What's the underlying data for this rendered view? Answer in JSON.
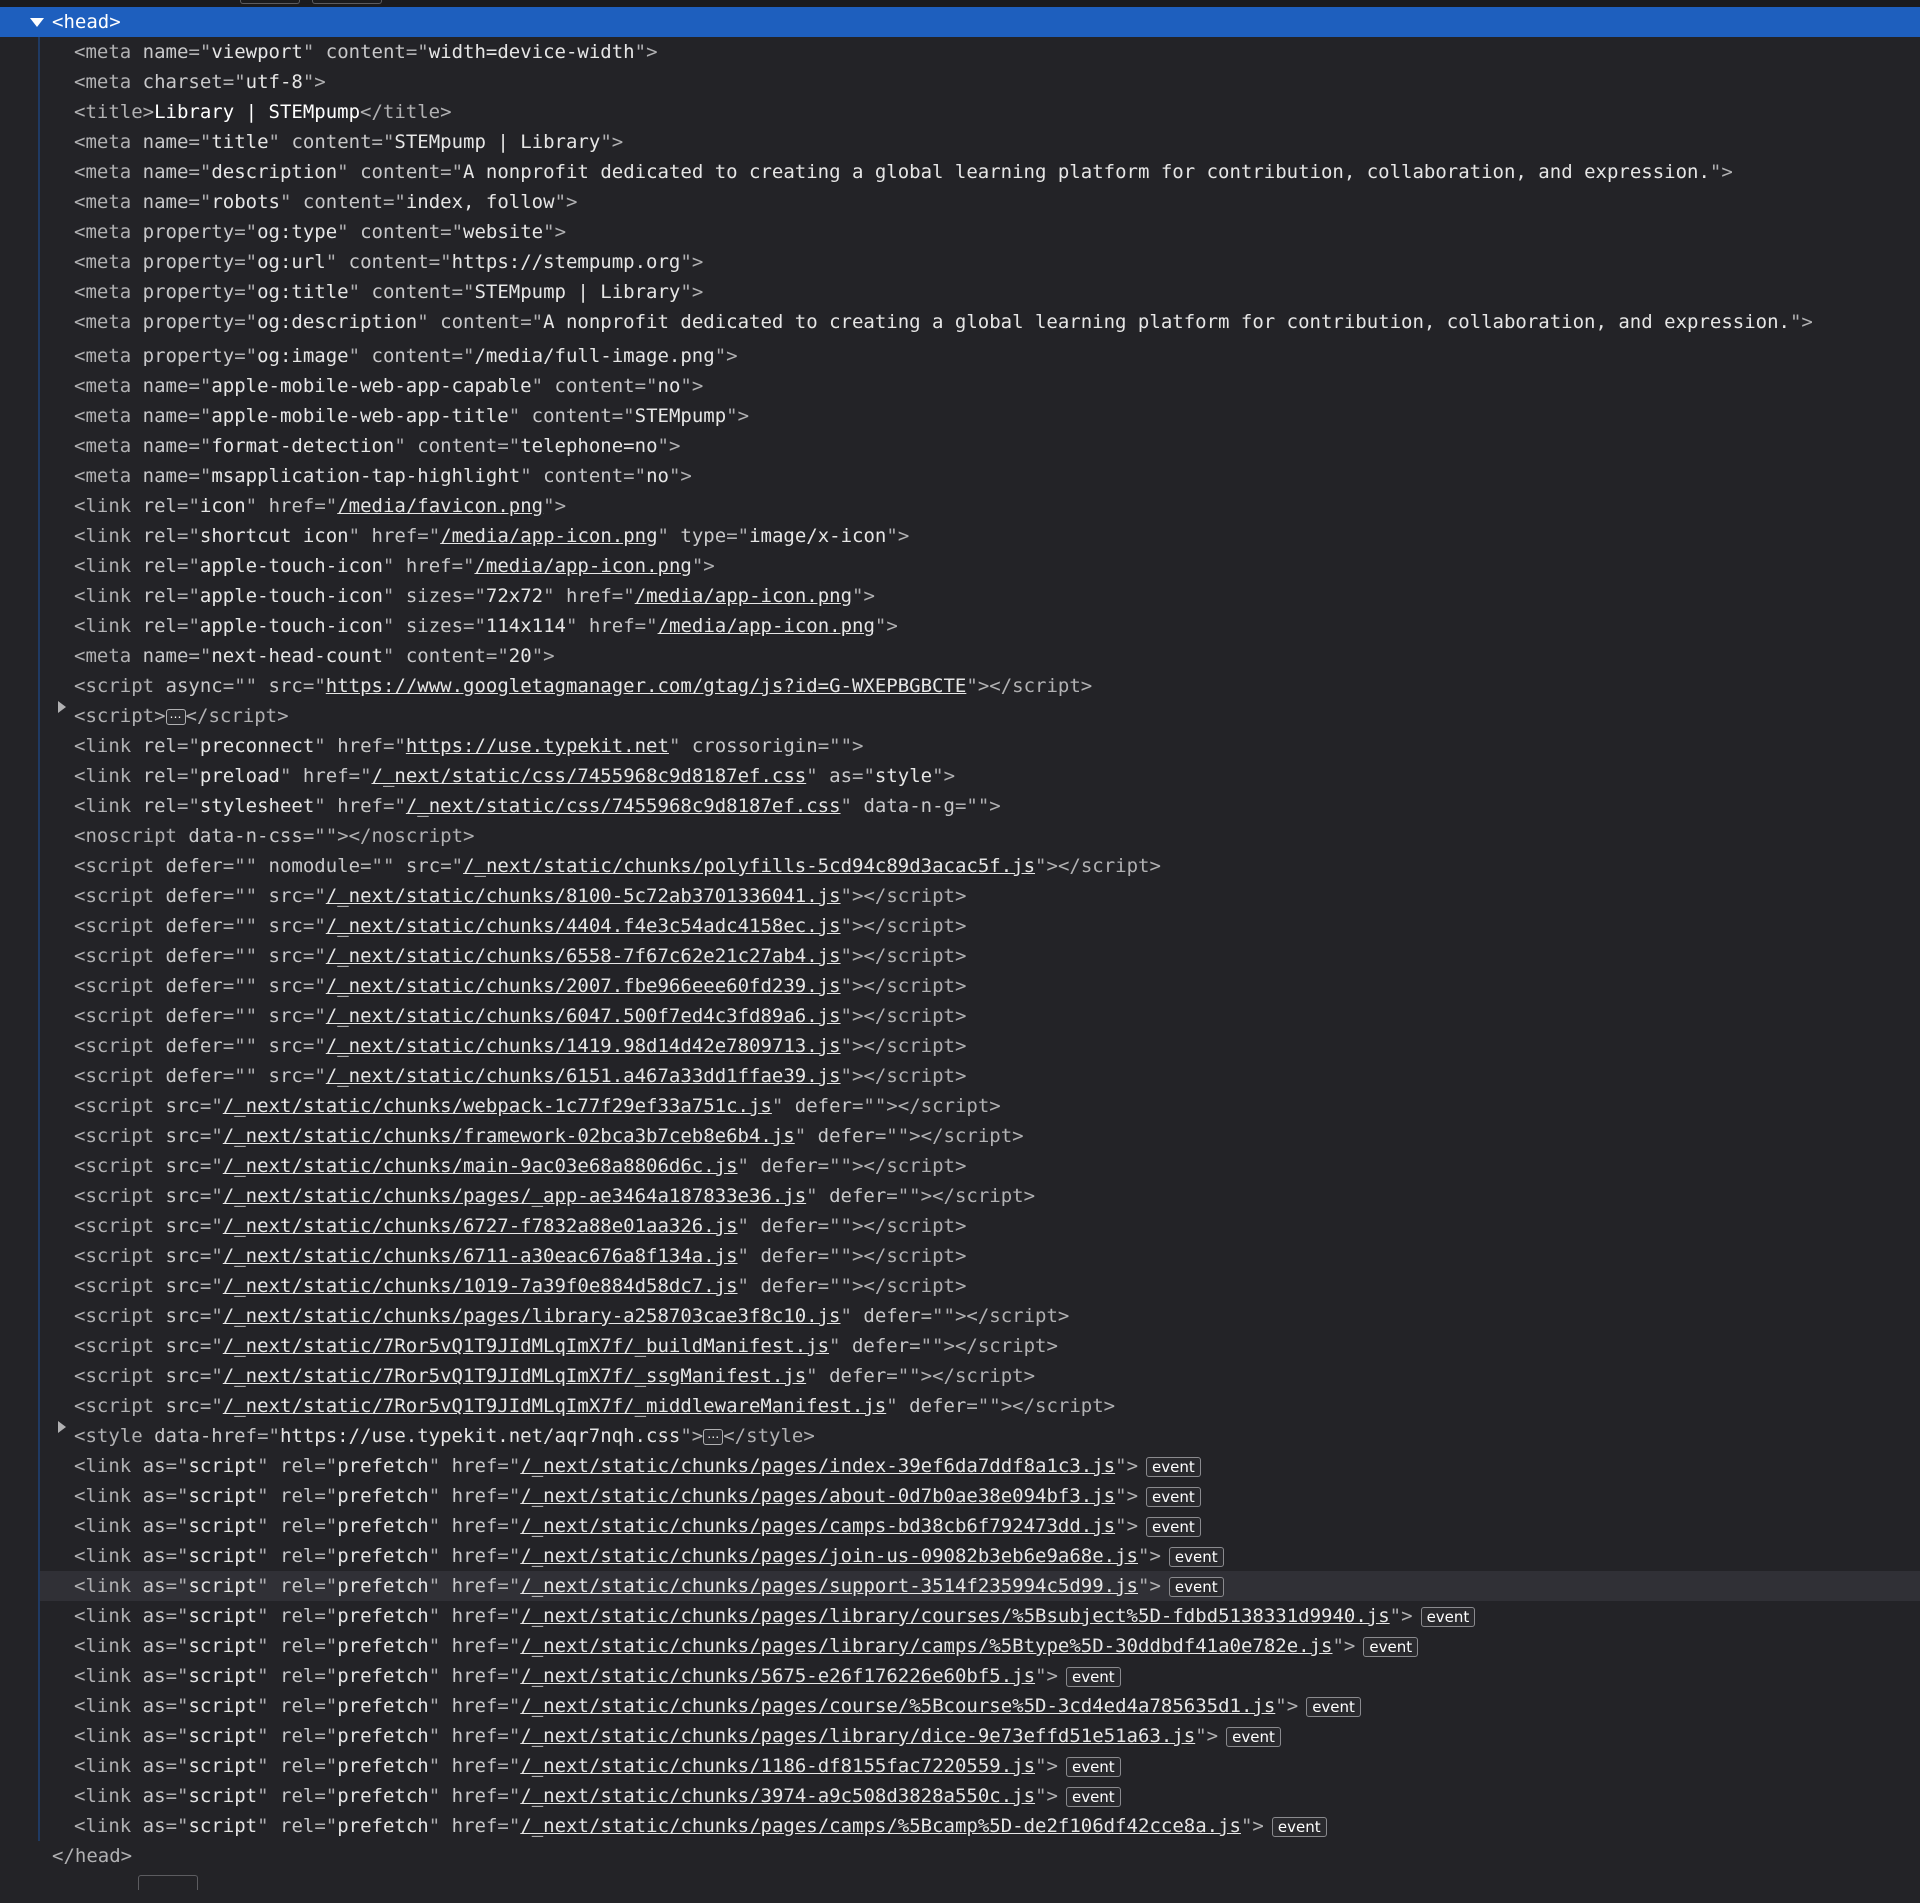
{
  "head_node": {
    "open": "<head>",
    "close": "</head>"
  },
  "badge_label": "event",
  "nodes": [
    {
      "kind": "attrs",
      "tag": "meta",
      "attrs": [
        [
          "name",
          "viewport"
        ],
        [
          "content",
          "width=device-width"
        ]
      ]
    },
    {
      "kind": "attrs",
      "tag": "meta",
      "attrs": [
        [
          "charset",
          "utf-8"
        ]
      ]
    },
    {
      "kind": "text",
      "tag": "title",
      "text": "Library | STEMpump"
    },
    {
      "kind": "attrs",
      "tag": "meta",
      "attrs": [
        [
          "name",
          "title"
        ],
        [
          "content",
          "STEMpump | Library"
        ]
      ]
    },
    {
      "kind": "attrs",
      "tag": "meta",
      "attrs": [
        [
          "name",
          "description"
        ],
        [
          "content",
          "A nonprofit dedicated to creating a global learning platform for contribution, collaboration, and expression."
        ]
      ]
    },
    {
      "kind": "attrs",
      "tag": "meta",
      "attrs": [
        [
          "name",
          "robots"
        ],
        [
          "content",
          "index, follow"
        ]
      ]
    },
    {
      "kind": "attrs",
      "tag": "meta",
      "attrs": [
        [
          "property",
          "og:type"
        ],
        [
          "content",
          "website"
        ]
      ]
    },
    {
      "kind": "attrs",
      "tag": "meta",
      "attrs": [
        [
          "property",
          "og:url"
        ],
        [
          "content",
          "https://stempump.org"
        ]
      ]
    },
    {
      "kind": "attrs",
      "tag": "meta",
      "attrs": [
        [
          "property",
          "og:title"
        ],
        [
          "content",
          "STEMpump | Library"
        ]
      ]
    },
    {
      "kind": "attrs",
      "tag": "meta",
      "wrap": true,
      "attrs": [
        [
          "property",
          "og:description"
        ],
        [
          "content",
          "A nonprofit dedicated to creating a global learning platform for contribution, collaboration, and expression."
        ]
      ]
    },
    {
      "kind": "attrs",
      "tag": "meta",
      "attrs": [
        [
          "property",
          "og:image"
        ],
        [
          "content",
          "/media/full-image.png"
        ]
      ]
    },
    {
      "kind": "attrs",
      "tag": "meta",
      "attrs": [
        [
          "name",
          "apple-mobile-web-app-capable"
        ],
        [
          "content",
          "no"
        ]
      ]
    },
    {
      "kind": "attrs",
      "tag": "meta",
      "attrs": [
        [
          "name",
          "apple-mobile-web-app-title"
        ],
        [
          "content",
          "STEMpump"
        ]
      ]
    },
    {
      "kind": "attrs",
      "tag": "meta",
      "attrs": [
        [
          "name",
          "format-detection"
        ],
        [
          "content",
          "telephone=no"
        ]
      ]
    },
    {
      "kind": "attrs",
      "tag": "meta",
      "attrs": [
        [
          "name",
          "msapplication-tap-highlight"
        ],
        [
          "content",
          "no"
        ]
      ]
    },
    {
      "kind": "attrs",
      "tag": "link",
      "attrs": [
        [
          "rel",
          "icon"
        ],
        [
          "href",
          "/media/favicon.png",
          true
        ]
      ]
    },
    {
      "kind": "attrs",
      "tag": "link",
      "attrs": [
        [
          "rel",
          "shortcut icon"
        ],
        [
          "href",
          "/media/app-icon.png",
          true
        ],
        [
          "type",
          "image/x-icon"
        ]
      ]
    },
    {
      "kind": "attrs",
      "tag": "link",
      "attrs": [
        [
          "rel",
          "apple-touch-icon"
        ],
        [
          "href",
          "/media/app-icon.png",
          true
        ]
      ]
    },
    {
      "kind": "attrs",
      "tag": "link",
      "attrs": [
        [
          "rel",
          "apple-touch-icon"
        ],
        [
          "sizes",
          "72x72"
        ],
        [
          "href",
          "/media/app-icon.png",
          true
        ]
      ]
    },
    {
      "kind": "attrs",
      "tag": "link",
      "attrs": [
        [
          "rel",
          "apple-touch-icon"
        ],
        [
          "sizes",
          "114x114"
        ],
        [
          "href",
          "/media/app-icon.png",
          true
        ]
      ]
    },
    {
      "kind": "attrs",
      "tag": "meta",
      "attrs": [
        [
          "name",
          "next-head-count"
        ],
        [
          "content",
          "20"
        ]
      ]
    },
    {
      "kind": "attrs",
      "tag": "script",
      "close": true,
      "attrs": [
        [
          "async",
          ""
        ],
        [
          "src",
          "https://www.googletagmanager.com/gtag/js?id=G-WXEPBGBCTE",
          true
        ]
      ]
    },
    {
      "kind": "collapsed",
      "tag": "script",
      "attrs": []
    },
    {
      "kind": "attrs",
      "tag": "link",
      "attrs": [
        [
          "rel",
          "preconnect"
        ],
        [
          "href",
          "https://use.typekit.net",
          true
        ],
        [
          "crossorigin",
          ""
        ]
      ]
    },
    {
      "kind": "attrs",
      "tag": "link",
      "attrs": [
        [
          "rel",
          "preload"
        ],
        [
          "href",
          "/_next/static/css/7455968c9d8187ef.css",
          true
        ],
        [
          "as",
          "style"
        ]
      ]
    },
    {
      "kind": "attrs",
      "tag": "link",
      "attrs": [
        [
          "rel",
          "stylesheet"
        ],
        [
          "href",
          "/_next/static/css/7455968c9d8187ef.css",
          true
        ],
        [
          "data-n-g",
          ""
        ]
      ]
    },
    {
      "kind": "attrs",
      "tag": "noscript",
      "close": true,
      "attrs": [
        [
          "data-n-css",
          ""
        ]
      ]
    },
    {
      "kind": "attrs",
      "tag": "script",
      "close": true,
      "attrs": [
        [
          "defer",
          ""
        ],
        [
          "nomodule",
          ""
        ],
        [
          "src",
          "/_next/static/chunks/polyfills-5cd94c89d3acac5f.js",
          true
        ]
      ]
    },
    {
      "kind": "attrs",
      "tag": "script",
      "close": true,
      "attrs": [
        [
          "defer",
          ""
        ],
        [
          "src",
          "/_next/static/chunks/8100-5c72ab3701336041.js",
          true
        ]
      ]
    },
    {
      "kind": "attrs",
      "tag": "script",
      "close": true,
      "attrs": [
        [
          "defer",
          ""
        ],
        [
          "src",
          "/_next/static/chunks/4404.f4e3c54adc4158ec.js",
          true
        ]
      ]
    },
    {
      "kind": "attrs",
      "tag": "script",
      "close": true,
      "attrs": [
        [
          "defer",
          ""
        ],
        [
          "src",
          "/_next/static/chunks/6558-7f67c62e21c27ab4.js",
          true
        ]
      ]
    },
    {
      "kind": "attrs",
      "tag": "script",
      "close": true,
      "attrs": [
        [
          "defer",
          ""
        ],
        [
          "src",
          "/_next/static/chunks/2007.fbe966eee60fd239.js",
          true
        ]
      ]
    },
    {
      "kind": "attrs",
      "tag": "script",
      "close": true,
      "attrs": [
        [
          "defer",
          ""
        ],
        [
          "src",
          "/_next/static/chunks/6047.500f7ed4c3fd89a6.js",
          true
        ]
      ]
    },
    {
      "kind": "attrs",
      "tag": "script",
      "close": true,
      "attrs": [
        [
          "defer",
          ""
        ],
        [
          "src",
          "/_next/static/chunks/1419.98d14d42e7809713.js",
          true
        ]
      ]
    },
    {
      "kind": "attrs",
      "tag": "script",
      "close": true,
      "attrs": [
        [
          "defer",
          ""
        ],
        [
          "src",
          "/_next/static/chunks/6151.a467a33dd1ffae39.js",
          true
        ]
      ]
    },
    {
      "kind": "attrs",
      "tag": "script",
      "close": true,
      "attrs": [
        [
          "src",
          "/_next/static/chunks/webpack-1c77f29ef33a751c.js",
          true
        ],
        [
          "defer",
          ""
        ]
      ]
    },
    {
      "kind": "attrs",
      "tag": "script",
      "close": true,
      "attrs": [
        [
          "src",
          "/_next/static/chunks/framework-02bca3b7ceb8e6b4.js",
          true
        ],
        [
          "defer",
          ""
        ]
      ]
    },
    {
      "kind": "attrs",
      "tag": "script",
      "close": true,
      "attrs": [
        [
          "src",
          "/_next/static/chunks/main-9ac03e68a8806d6c.js",
          true
        ],
        [
          "defer",
          ""
        ]
      ]
    },
    {
      "kind": "attrs",
      "tag": "script",
      "close": true,
      "attrs": [
        [
          "src",
          "/_next/static/chunks/pages/_app-ae3464a187833e36.js",
          true
        ],
        [
          "defer",
          ""
        ]
      ]
    },
    {
      "kind": "attrs",
      "tag": "script",
      "close": true,
      "attrs": [
        [
          "src",
          "/_next/static/chunks/6727-f7832a88e01aa326.js",
          true
        ],
        [
          "defer",
          ""
        ]
      ]
    },
    {
      "kind": "attrs",
      "tag": "script",
      "close": true,
      "attrs": [
        [
          "src",
          "/_next/static/chunks/6711-a30eac676a8f134a.js",
          true
        ],
        [
          "defer",
          ""
        ]
      ]
    },
    {
      "kind": "attrs",
      "tag": "script",
      "close": true,
      "attrs": [
        [
          "src",
          "/_next/static/chunks/1019-7a39f0e884d58dc7.js",
          true
        ],
        [
          "defer",
          ""
        ]
      ]
    },
    {
      "kind": "attrs",
      "tag": "script",
      "close": true,
      "attrs": [
        [
          "src",
          "/_next/static/chunks/pages/library-a258703cae3f8c10.js",
          true
        ],
        [
          "defer",
          ""
        ]
      ]
    },
    {
      "kind": "attrs",
      "tag": "script",
      "close": true,
      "attrs": [
        [
          "src",
          "/_next/static/7Ror5vQ1T9JIdMLqImX7f/_buildManifest.js",
          true
        ],
        [
          "defer",
          ""
        ]
      ]
    },
    {
      "kind": "attrs",
      "tag": "script",
      "close": true,
      "attrs": [
        [
          "src",
          "/_next/static/7Ror5vQ1T9JIdMLqImX7f/_ssgManifest.js",
          true
        ],
        [
          "defer",
          ""
        ]
      ]
    },
    {
      "kind": "attrs",
      "tag": "script",
      "close": true,
      "attrs": [
        [
          "src",
          "/_next/static/7Ror5vQ1T9JIdMLqImX7f/_middlewareManifest.js",
          true
        ],
        [
          "defer",
          ""
        ]
      ]
    },
    {
      "kind": "collapsed",
      "tag": "style",
      "attrs": [
        [
          "data-href",
          "https://use.typekit.net/aqr7nqh.css"
        ]
      ]
    },
    {
      "kind": "attrs",
      "tag": "link",
      "event": true,
      "attrs": [
        [
          "as",
          "script"
        ],
        [
          "rel",
          "prefetch"
        ],
        [
          "href",
          "/_next/static/chunks/pages/index-39ef6da7ddf8a1c3.js",
          true
        ]
      ]
    },
    {
      "kind": "attrs",
      "tag": "link",
      "event": true,
      "attrs": [
        [
          "as",
          "script"
        ],
        [
          "rel",
          "prefetch"
        ],
        [
          "href",
          "/_next/static/chunks/pages/about-0d7b0ae38e094bf3.js",
          true
        ]
      ]
    },
    {
      "kind": "attrs",
      "tag": "link",
      "event": true,
      "attrs": [
        [
          "as",
          "script"
        ],
        [
          "rel",
          "prefetch"
        ],
        [
          "href",
          "/_next/static/chunks/pages/camps-bd38cb6f792473dd.js",
          true
        ]
      ]
    },
    {
      "kind": "attrs",
      "tag": "link",
      "event": true,
      "attrs": [
        [
          "as",
          "script"
        ],
        [
          "rel",
          "prefetch"
        ],
        [
          "href",
          "/_next/static/chunks/pages/join-us-09082b3eb6e9a68e.js",
          true
        ]
      ]
    },
    {
      "kind": "attrs",
      "tag": "link",
      "event": true,
      "highlight": true,
      "attrs": [
        [
          "as",
          "script"
        ],
        [
          "rel",
          "prefetch"
        ],
        [
          "href",
          "/_next/static/chunks/pages/support-3514f235994c5d99.js",
          true
        ]
      ]
    },
    {
      "kind": "attrs",
      "tag": "link",
      "event": true,
      "attrs": [
        [
          "as",
          "script"
        ],
        [
          "rel",
          "prefetch"
        ],
        [
          "href",
          "/_next/static/chunks/pages/library/courses/%5Bsubject%5D-fdbd5138331d9940.js",
          true
        ]
      ]
    },
    {
      "kind": "attrs",
      "tag": "link",
      "event": true,
      "attrs": [
        [
          "as",
          "script"
        ],
        [
          "rel",
          "prefetch"
        ],
        [
          "href",
          "/_next/static/chunks/pages/library/camps/%5Btype%5D-30ddbdf41a0e782e.js",
          true
        ]
      ]
    },
    {
      "kind": "attrs",
      "tag": "link",
      "event": true,
      "attrs": [
        [
          "as",
          "script"
        ],
        [
          "rel",
          "prefetch"
        ],
        [
          "href",
          "/_next/static/chunks/5675-e26f176226e60bf5.js",
          true
        ]
      ]
    },
    {
      "kind": "attrs",
      "tag": "link",
      "event": true,
      "attrs": [
        [
          "as",
          "script"
        ],
        [
          "rel",
          "prefetch"
        ],
        [
          "href",
          "/_next/static/chunks/pages/course/%5Bcourse%5D-3cd4ed4a785635d1.js",
          true
        ]
      ]
    },
    {
      "kind": "attrs",
      "tag": "link",
      "event": true,
      "attrs": [
        [
          "as",
          "script"
        ],
        [
          "rel",
          "prefetch"
        ],
        [
          "href",
          "/_next/static/chunks/pages/library/dice-9e73effd51e51a63.js",
          true
        ]
      ]
    },
    {
      "kind": "attrs",
      "tag": "link",
      "event": true,
      "attrs": [
        [
          "as",
          "script"
        ],
        [
          "rel",
          "prefetch"
        ],
        [
          "href",
          "/_next/static/chunks/1186-df8155fac7220559.js",
          true
        ]
      ]
    },
    {
      "kind": "attrs",
      "tag": "link",
      "event": true,
      "attrs": [
        [
          "as",
          "script"
        ],
        [
          "rel",
          "prefetch"
        ],
        [
          "href",
          "/_next/static/chunks/3974-a9c508d3828a550c.js",
          true
        ]
      ]
    },
    {
      "kind": "attrs",
      "tag": "link",
      "event": true,
      "attrs": [
        [
          "as",
          "script"
        ],
        [
          "rel",
          "prefetch"
        ],
        [
          "href",
          "/_next/static/chunks/pages/camps/%5Bcamp%5D-de2f106df42cce8a.js",
          true
        ]
      ]
    }
  ]
}
